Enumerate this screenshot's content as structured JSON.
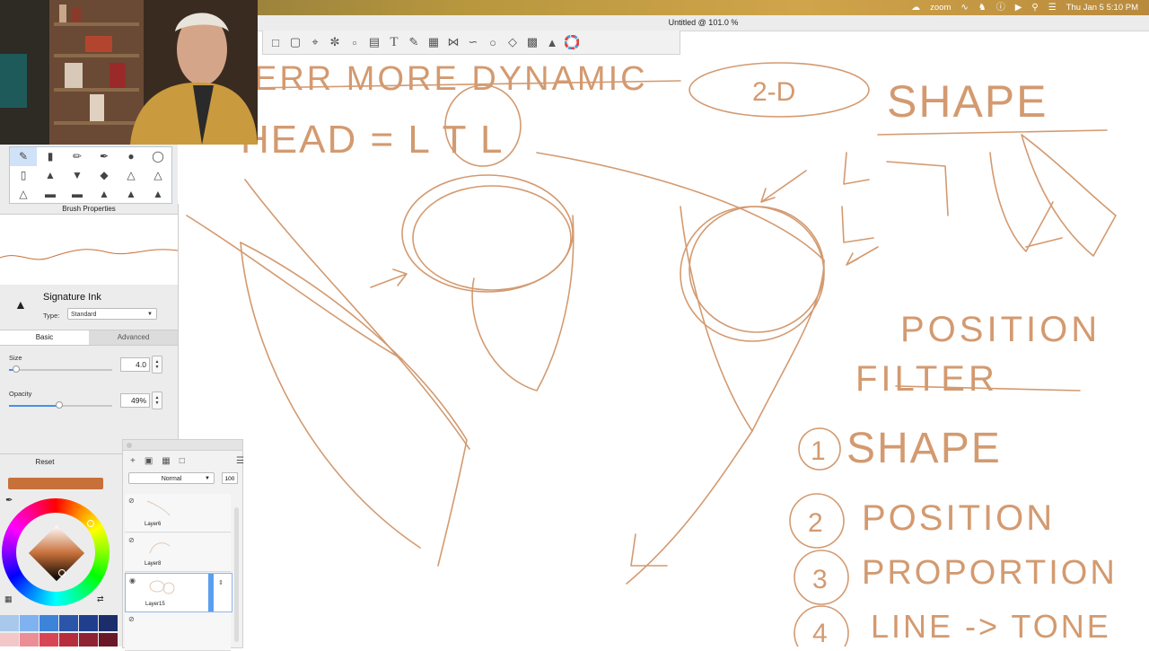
{
  "menubar": {
    "zoom_label": "zoom",
    "datetime": "Thu Jan 5  5:10 PM",
    "icons": [
      "creative-cloud-icon",
      "zoom-app-icon",
      "wifi-icon",
      "camel-icon",
      "info-icon",
      "play-icon",
      "search-icon",
      "control-center-icon",
      "user-icon"
    ]
  },
  "window": {
    "title": "Untitled @ 101.0 %"
  },
  "toolbar": {
    "tools": [
      "transform-tool-icon",
      "crop-tool-icon",
      "lasso-tool-icon",
      "text-tool-icon",
      "symmetry-tool-icon",
      "perspective-tool-icon",
      "ellipse-tool-icon",
      "color-wheel-icon"
    ],
    "text_tool_glyph": "T"
  },
  "brush_library": {
    "selected_index": 0
  },
  "brush_properties": {
    "title": "Brush Properties",
    "brush_name": "Signature Ink",
    "type_label": "Type:",
    "type_value": "Standard",
    "tabs": {
      "basic": "Basic",
      "advanced": "Advanced"
    },
    "size": {
      "label": "Size",
      "value": "4.0",
      "fraction": 0.07
    },
    "opacity": {
      "label": "Opacity",
      "value": "49%",
      "fraction": 0.49
    }
  },
  "reset": {
    "label": "Reset"
  },
  "color": {
    "current": "#c8703a",
    "swatches_row1": [
      "#a9c9ec",
      "#7fb2ee",
      "#3d83d9",
      "#2a55a8",
      "#1f3f8c",
      "#1b2d6b"
    ],
    "swatches_row2": [
      "#f3c6c8",
      "#ec8e95",
      "#d84656",
      "#b72d3c",
      "#8e2232",
      "#6a1828"
    ]
  },
  "layers": {
    "blend_mode": "Normal",
    "opacity": "100",
    "items": [
      {
        "name": "Layer6",
        "selected": false
      },
      {
        "name": "Layer8",
        "selected": false
      },
      {
        "name": "Layer15",
        "selected": true
      },
      {
        "name": "",
        "selected": false
      }
    ]
  },
  "canvas": {
    "stroke_color": "#d39a70",
    "notes": {
      "header_line1": "ERR MORE DYNAMIC",
      "header_line2": "HEAD = L T L",
      "circle_2d": "2-D",
      "shape_title": "SHAPE",
      "position_title": "POSITION",
      "filter_title": "FILTER",
      "list": [
        "SHAPE",
        "POSITION",
        "PROPORTION",
        "LINE -> TONE"
      ],
      "list_numbers": [
        "1",
        "2",
        "3",
        "4"
      ]
    }
  }
}
